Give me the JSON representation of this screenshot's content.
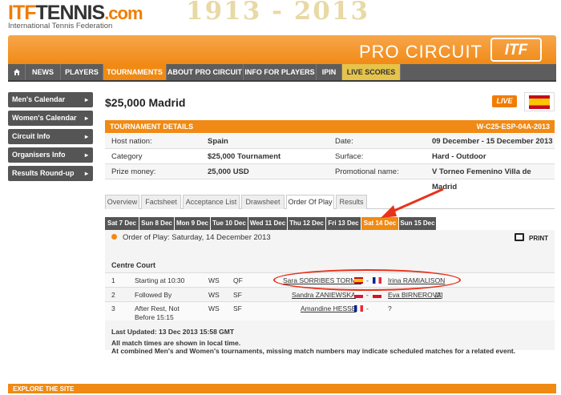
{
  "site": {
    "logo_itf": "ITF",
    "logo_tennis": "TENNIS",
    "logo_com": ".com",
    "logo_sub": "International Tennis Federation",
    "logo_years": "1913 - 2013"
  },
  "banner": {
    "title": "PRO CIRCUIT",
    "badge": "ITF"
  },
  "nav": {
    "items": [
      "NEWS",
      "PLAYERS",
      "TOURNAMENTS",
      "ABOUT PRO CIRCUIT",
      "INFO FOR PLAYERS",
      "IPIN",
      "LIVE SCORES"
    ],
    "home_icon": "home-icon"
  },
  "sidebar": {
    "items": [
      {
        "label": "Men's Calendar"
      },
      {
        "label": "Women's Calendar"
      },
      {
        "label": "Circuit Info"
      },
      {
        "label": "Organisers Info"
      },
      {
        "label": "Results Round-up"
      }
    ],
    "arrow": "▸"
  },
  "page": {
    "title": "$25,000 Madrid",
    "live": "LIVE"
  },
  "details": {
    "header": "TOURNAMENT DETAILS",
    "code": "W-C25-ESP-04A-2013",
    "rows": [
      {
        "l1": "Host nation:",
        "v1": "Spain",
        "l2": "Date:",
        "v2": "09 December - 15 December 2013"
      },
      {
        "l1": "Category",
        "v1": "$25,000 Tournament",
        "l2": "Surface:",
        "v2": "Hard - Outdoor"
      },
      {
        "l1": "Prize money:",
        "v1": "25,000 USD",
        "l2": "Promotional name:",
        "v2": "V Torneo Femenino Villa de Madrid"
      }
    ]
  },
  "tabs": [
    "Overview",
    "Factsheet",
    "Acceptance List",
    "Drawsheet",
    "Order Of Play",
    "Results"
  ],
  "days": [
    "Sat 7 Dec",
    "Sun 8 Dec",
    "Mon 9 Dec",
    "Tue 10 Dec",
    "Wed 11 Dec",
    "Thu 12 Dec",
    "Fri 13 Dec",
    "Sat 14 Dec",
    "Sun 15 Dec"
  ],
  "oop": {
    "title": "Order of Play: Saturday, 14 December 2013",
    "print": "PRINT",
    "court": "Centre Court",
    "matches": [
      {
        "num": "1",
        "time": "Starting at 10:30",
        "event": "WS",
        "round": "QF",
        "p1": "Sara SORRIBES TORMO",
        "sep": "-",
        "p2": "Irina RAMIALISON",
        "extra": ""
      },
      {
        "num": "2",
        "time": "Followed By",
        "event": "WS",
        "round": "SF",
        "p1": "Sandra ZANIEWSKA",
        "sep": "-",
        "p2": "Eva BIRNEROVA",
        "extra": "[2]"
      },
      {
        "num": "3",
        "time": "After Rest, Not Before 15:15",
        "event": "WS",
        "round": "SF",
        "p1": "Amandine HESSE",
        "sep": "-",
        "p2": "?",
        "extra": ""
      }
    ],
    "updated": "Last Updated: 13 Dec 2013 15:58 GMT",
    "note1": "All match times are shown in local time.",
    "note2": "At combined Men's and Women's tournaments, missing match numbers may indicate scheduled matches for a related event."
  },
  "footer": {
    "label": "EXPLORE THE SITE"
  },
  "colors": {
    "accent": "#f08a14",
    "nav": "#5d5d5d",
    "annotation": "#e8321a"
  }
}
